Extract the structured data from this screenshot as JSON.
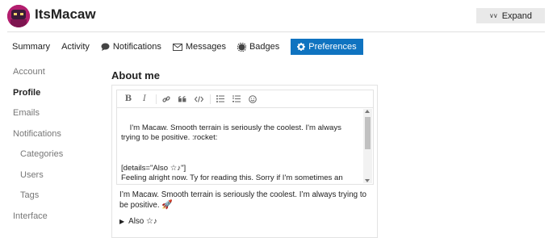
{
  "header": {
    "username": "ItsMacaw",
    "expand_label": "Expand",
    "avatar_color": "#b31e6f"
  },
  "tabs": [
    {
      "label": "Summary",
      "icon": ""
    },
    {
      "label": "Activity",
      "icon": ""
    },
    {
      "label": "Notifications",
      "icon": "comment-icon"
    },
    {
      "label": "Messages",
      "icon": "envelope-icon"
    },
    {
      "label": "Badges",
      "icon": "badge-icon"
    },
    {
      "label": "Preferences",
      "icon": "gear-icon",
      "active": true
    }
  ],
  "sidebar": {
    "items": [
      {
        "label": "Account"
      },
      {
        "label": "Profile",
        "active": true
      },
      {
        "label": "Emails"
      },
      {
        "label": "Notifications"
      },
      {
        "label": "Categories",
        "sub": true
      },
      {
        "label": "Users",
        "sub": true
      },
      {
        "label": "Tags",
        "sub": true
      },
      {
        "label": "Interface"
      }
    ]
  },
  "about": {
    "title": "About me",
    "toolbar": [
      "bold-icon",
      "italic-icon",
      "link-icon",
      "quote-icon",
      "code-icon",
      "bullet-list-icon",
      "numbered-list-icon",
      "emoji-icon"
    ],
    "editor_text": "I'm Macaw. Smooth terrain is seriously the coolest. I'm always trying to be positive. :rocket:\n\n\n[details=\"Also ☆♪\"]\nFeeling alright now. Ty for reading this. Sorry if I'm sometimes an idiot. :neutral_face:",
    "preview_text": "I’m Macaw. Smooth terrain is seriously the coolest. I’m always trying to be positive.",
    "preview_emoji": "🚀",
    "details_label": "Also ☆♪"
  },
  "colors": {
    "accent": "#0f73c0",
    "muted_text": "#777777"
  }
}
